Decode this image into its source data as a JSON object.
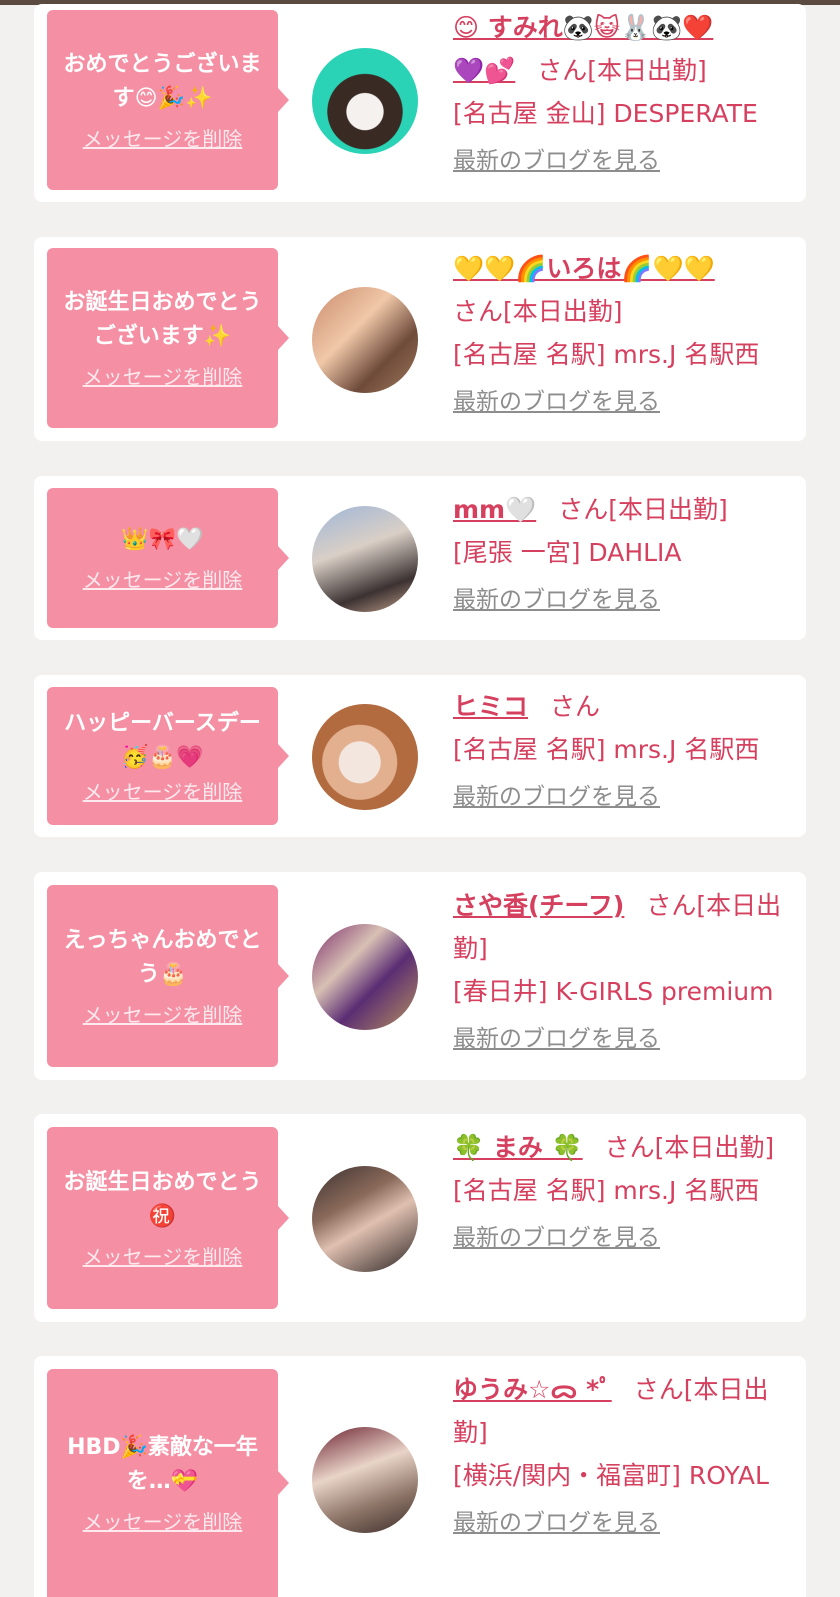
{
  "delete_label": "メッセージを削除",
  "blog_label": "最新のブログを見る",
  "messages": [
    {
      "message": "おめでとうございます😊🎉✨",
      "name": "😊 すみれ🐼😺🐰🐼❤️💜💕",
      "name_line1": "😊 すみれ🐼😺🐰🐼❤️",
      "name_line2": "💜💕",
      "suffix": "さん[本日出勤]",
      "shop": "[名古屋 金山] DESPERATE"
    },
    {
      "message": "お誕生日おめでとうございます✨",
      "name": "💛💛🌈いろは🌈💛💛",
      "suffix": "さん[本日出勤]",
      "shop": "[名古屋 名駅] mrs.J 名駅西"
    },
    {
      "message": "👑🎀🤍",
      "name": "mm🤍",
      "suffix": "さん[本日出勤]",
      "shop": "[尾張 一宮] DAHLIA"
    },
    {
      "message": "ハッピーバースデー🥳🎂💗",
      "name": "ヒミコ",
      "suffix": "さん",
      "shop": "[名古屋 名駅] mrs.J 名駅西"
    },
    {
      "message": "えっちゃんおめでとう🎂",
      "name": "さや香(チーフ)",
      "suffix": "さん[本日出勤]",
      "shop": "[春日井] K-GIRLS premium"
    },
    {
      "message": "お誕生日おめでとう㊗️",
      "name": "🍀 まみ 🍀",
      "suffix": "さん[本日出勤]",
      "shop": "[名古屋 名駅] mrs.J 名駅西"
    },
    {
      "message": "HBD🎉素敵な一年を…💝",
      "name": "ゆうみ☆ᯅ *ﾟ",
      "suffix": "さん[本日出勤]",
      "shop": "[横浜/関内・福富町] ROYAL"
    }
  ]
}
